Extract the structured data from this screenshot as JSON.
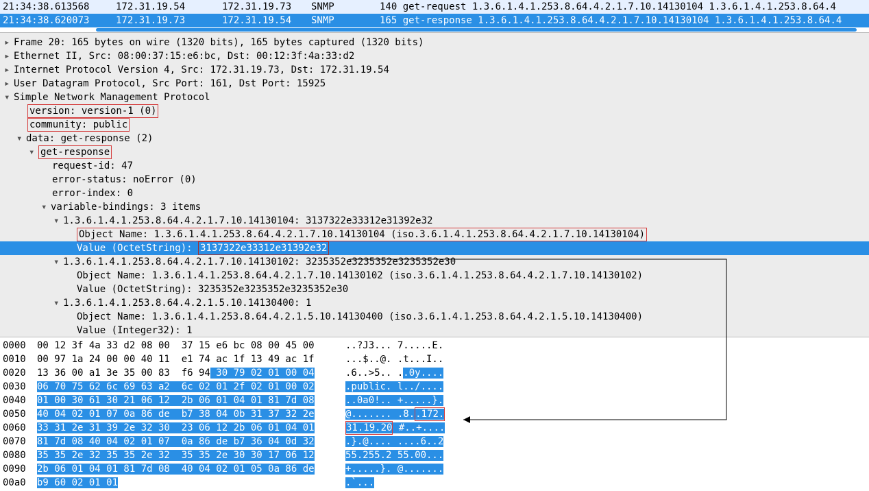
{
  "packet_list": {
    "rows": [
      {
        "time": "21:34:38.613568",
        "src": "172.31.19.54",
        "dst": "172.31.19.73",
        "proto": "SNMP",
        "info": "140 get-request 1.3.6.1.4.1.253.8.64.4.2.1.7.10.14130104 1.3.6.1.4.1.253.8.64.4",
        "cls": "even"
      },
      {
        "time": "21:34:38.620073",
        "src": "172.31.19.73",
        "dst": "172.31.19.54",
        "proto": "SNMP",
        "info": "165 get-response 1.3.6.1.4.1.253.8.64.4.2.1.7.10.14130104 1.3.6.1.4.1.253.8.64.4",
        "cls": "selected"
      }
    ]
  },
  "details": {
    "frame": "Frame 20: 165 bytes on wire (1320 bits), 165 bytes captured (1320 bits)",
    "eth": "Ethernet II, Src: 08:00:37:15:e6:bc, Dst: 00:12:3f:4a:33:d2",
    "ip": "Internet Protocol Version 4, Src: 172.31.19.73, Dst: 172.31.19.54",
    "udp": "User Datagram Protocol, Src Port: 161, Dst Port: 15925",
    "snmp": "Simple Network Management Protocol",
    "version": "version: version-1 (0)",
    "community": "community: public",
    "data": "data: get-response (2)",
    "getresp": "get-response",
    "reqid": "request-id: 47",
    "errstat": "error-status: noError (0)",
    "erridx": "error-index: 0",
    "varbind": "variable-bindings: 3 items",
    "vb1": "1.3.6.1.4.1.253.8.64.4.2.1.7.10.14130104: 3137322e33312e31392e32",
    "vb1_name": "Object Name: 1.3.6.1.4.1.253.8.64.4.2.1.7.10.14130104 (iso.3.6.1.4.1.253.8.64.4.2.1.7.10.14130104)",
    "vb1_val_label": "Value (OctetString): ",
    "vb1_val": "3137322e33312e31392e32",
    "vb2": "1.3.6.1.4.1.253.8.64.4.2.1.7.10.14130102: 3235352e3235352e3235352e30",
    "vb2_name": "Object Name: 1.3.6.1.4.1.253.8.64.4.2.1.7.10.14130102 (iso.3.6.1.4.1.253.8.64.4.2.1.7.10.14130102)",
    "vb2_val": "Value (OctetString): 3235352e3235352e3235352e30",
    "vb3": "1.3.6.1.4.1.253.8.64.4.2.1.5.10.14130400: 1",
    "vb3_name": "Object Name: 1.3.6.1.4.1.253.8.64.4.2.1.5.10.14130400 (iso.3.6.1.4.1.253.8.64.4.2.1.5.10.14130400)",
    "vb3_val": "Value (Integer32): 1"
  },
  "hex": {
    "lines": [
      {
        "off": "0000",
        "h": "00 12 3f 4a 33 d2 08 00  37 15 e6 bc 08 00 45 00",
        "a": "..?J3... 7.....E.",
        "hl_h_from": -1,
        "hl_a_from": -1
      },
      {
        "off": "0010",
        "h": "00 97 1a 24 00 00 40 11  e1 74 ac 1f 13 49 ac 1f",
        "a": "...$..@. .t...I..",
        "hl_h_from": -1,
        "hl_a_from": -1
      },
      {
        "off": "0020",
        "h": "13 36 00 a1 3e 35 00 83  f6 94 30 79 02 01 00 04",
        "a": ".6..>5.. ..0y....",
        "hl_h_from": 30,
        "hl_a_from": 10
      },
      {
        "off": "0030",
        "h": "06 70 75 62 6c 69 63 a2  6c 02 01 2f 02 01 00 02",
        "a": ".public. l../....",
        "hl_h_from": 0,
        "hl_a_from": 0
      },
      {
        "off": "0040",
        "h": "01 00 30 61 30 21 06 12  2b 06 01 04 01 81 7d 08",
        "a": "..0a0!.. +.....}.",
        "hl_h_from": 0,
        "hl_a_from": 0
      },
      {
        "off": "0050",
        "h": "40 04 02 01 07 0a 86 de  b7 38 04 0b 31 37 32 2e",
        "a": "@....... .8..172.",
        "hl_h_from": 0,
        "hl_a_from": 0,
        "ascbox_from": 12,
        "ascbox_to": 16
      },
      {
        "off": "0060",
        "h": "33 31 2e 31 39 2e 32 30  23 06 12 2b 06 01 04 01",
        "a": "31.19.20 #..+....",
        "hl_h_from": 0,
        "hl_a_from": 0,
        "ascbox_from": 0,
        "ascbox_to": 7
      },
      {
        "off": "0070",
        "h": "81 7d 08 40 04 02 01 07  0a 86 de b7 36 04 0d 32",
        "a": ".}.@.... ....6..2",
        "hl_h_from": 0,
        "hl_a_from": 0
      },
      {
        "off": "0080",
        "h": "35 35 2e 32 35 35 2e 32  35 35 2e 30 30 17 06 12",
        "a": "55.255.2 55.00...",
        "hl_h_from": 0,
        "hl_a_from": 0
      },
      {
        "off": "0090",
        "h": "2b 06 01 04 01 81 7d 08  40 04 02 01 05 0a 86 de",
        "a": "+.....}. @.......",
        "hl_h_from": 0,
        "hl_a_from": 0
      },
      {
        "off": "00a0",
        "h": "b9 60 02 01 01",
        "a": ".`...",
        "hl_h_from": 0,
        "hl_a_from": 0
      }
    ]
  }
}
